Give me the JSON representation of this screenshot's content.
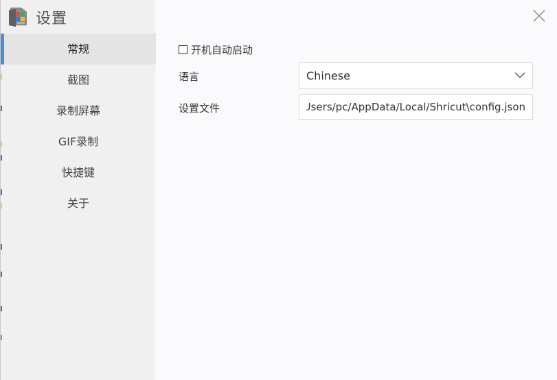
{
  "app": {
    "title": "设置",
    "icon": "app-logo-icon"
  },
  "window": {
    "close_icon": "close-icon"
  },
  "sidebar": {
    "items": [
      {
        "label": "常规",
        "active": true
      },
      {
        "label": "截图",
        "active": false
      },
      {
        "label": "录制屏幕",
        "active": false
      },
      {
        "label": "GIF录制",
        "active": false
      },
      {
        "label": "快捷键",
        "active": false
      },
      {
        "label": "关于",
        "active": false
      }
    ]
  },
  "general": {
    "autostart": {
      "label": "开机自动启动",
      "checked": false
    },
    "language": {
      "label": "语言",
      "value": "Chinese",
      "icon": "chevron-down-icon"
    },
    "config_file": {
      "label": "设置文件",
      "value": "C:/Users/pc/AppData/Local/Shricut\\config.json"
    }
  },
  "colors": {
    "accent": "#4a90d9",
    "sidebar_bg": "#f0f0f0",
    "sidebar_active_bg": "#e4e4e4",
    "content_bg": "#fafafc"
  }
}
